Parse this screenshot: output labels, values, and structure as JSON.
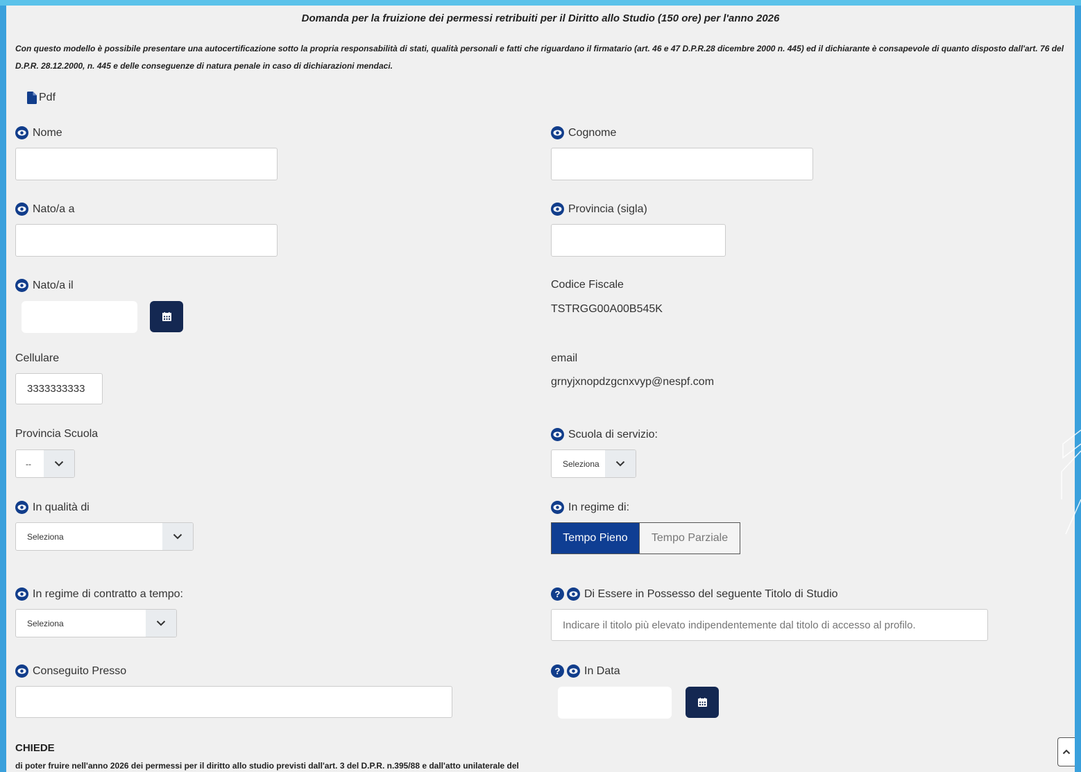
{
  "title": "Domanda per la fruizione dei permessi retribuiti per il Diritto allo Studio (150 ore) per l'anno 2026",
  "intro": "Con questo modello è possibile presentare una autocertificazione sotto la propria responsabilità di stati, qualità personali e fatti che riguardano il firmatario (art. 46 e 47 D.P.R.28 dicembre 2000 n. 445) ed il dichiarante è consapevole di quanto disposto dall'art. 76 del D.P.R. 28.12.2000, n. 445 e delle conseguenze di natura penale in caso di dichiarazioni mendaci.",
  "pdf_link": {
    "label": "Pdf",
    "icon": "file-icon"
  },
  "colors": {
    "accent": "#113d8b",
    "calendar_button": "#142852",
    "toggle_active": "#0f3e93"
  },
  "fields": {
    "nome": {
      "label": "Nome",
      "value": ""
    },
    "cognome": {
      "label": "Cognome",
      "value": ""
    },
    "nato_a": {
      "label": "Nato/a a",
      "value": ""
    },
    "provincia": {
      "label": "Provincia (sigla)",
      "value": ""
    },
    "nato_il": {
      "label": "Nato/a il",
      "value": ""
    },
    "codice_fiscale": {
      "label": "Codice Fiscale",
      "value": "TSTRGG00A00B545K"
    },
    "cellulare": {
      "label": "Cellulare",
      "value": "3333333333"
    },
    "email": {
      "label": "email",
      "value": "grnyjxnopdzgcnxvyp@nespf.com"
    },
    "provincia_scuola": {
      "label": "Provincia Scuola",
      "selected": "--"
    },
    "scuola_servizio": {
      "label": "Scuola di servizio:",
      "selected": "Seleziona"
    },
    "qualita": {
      "label": "In qualità di",
      "selected": "Seleziona"
    },
    "regime": {
      "label": "In regime di:",
      "options": [
        "Tempo Pieno",
        "Tempo Parziale"
      ],
      "selected": "Tempo Pieno"
    },
    "contratto": {
      "label": "In regime di contratto a tempo:",
      "selected": "Seleziona"
    },
    "titolo_studio": {
      "label": "Di Essere in Possesso del seguente Titolo di Studio",
      "placeholder": "Indicare il titolo più elevato indipendentemente dal titolo di accesso al profilo."
    },
    "conseguito_presso": {
      "label": "Conseguito Presso",
      "value": ""
    },
    "in_data": {
      "label": "In Data",
      "value": ""
    }
  },
  "chiede": {
    "heading": "CHIEDE",
    "text": "di poter fruire nell'anno 2026 dei permessi per il diritto allo studio previsti dall'art. 3 del D.P.R. n.395/88 e dall'atto unilaterale del"
  }
}
